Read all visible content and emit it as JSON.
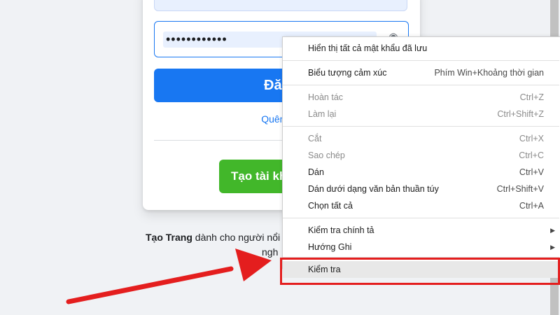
{
  "login": {
    "password_value": "••••••••••••",
    "login_button_label": "Đăng",
    "forgot_link": "Quên mậ",
    "create_account_label": "Tạo tài kh"
  },
  "footer": {
    "create_page_bold": "Tạo Trang",
    "create_page_rest": " dành cho người nổi",
    "create_page_line2": "ngh"
  },
  "context_menu": {
    "groups": [
      [
        {
          "label": "Hiển thị tất cả mật khẩu đã lưu",
          "shortcut": "",
          "disabled": false
        }
      ],
      [
        {
          "label": "Biểu tượng cảm xúc",
          "shortcut": "Phím Win+Khoảng thời gian",
          "disabled": false
        }
      ],
      [
        {
          "label": "Hoàn tác",
          "shortcut": "Ctrl+Z",
          "disabled": true
        },
        {
          "label": "Làm lại",
          "shortcut": "Ctrl+Shift+Z",
          "disabled": true
        }
      ],
      [
        {
          "label": "Cắt",
          "shortcut": "Ctrl+X",
          "disabled": true
        },
        {
          "label": "Sao chép",
          "shortcut": "Ctrl+C",
          "disabled": true
        },
        {
          "label": "Dán",
          "shortcut": "Ctrl+V",
          "disabled": false
        },
        {
          "label": "Dán dưới dạng văn bản thuần túy",
          "shortcut": "Ctrl+Shift+V",
          "disabled": false
        },
        {
          "label": "Chọn tất cả",
          "shortcut": "Ctrl+A",
          "disabled": false
        }
      ],
      [
        {
          "label": "Kiểm tra chính tả",
          "shortcut": "",
          "disabled": false,
          "submenu": true
        },
        {
          "label": "Hướng Ghi",
          "shortcut": "",
          "disabled": false,
          "submenu": true
        }
      ],
      [
        {
          "label": "Kiểm tra",
          "shortcut": "",
          "disabled": false,
          "highlighted": true
        }
      ]
    ]
  },
  "colors": {
    "brand_blue": "#1877f2",
    "green": "#42b72a",
    "annotation_red": "#e41e1e"
  },
  "icons": {
    "password_toggle": "eye-icon",
    "submenu": "chevron-right-icon"
  }
}
